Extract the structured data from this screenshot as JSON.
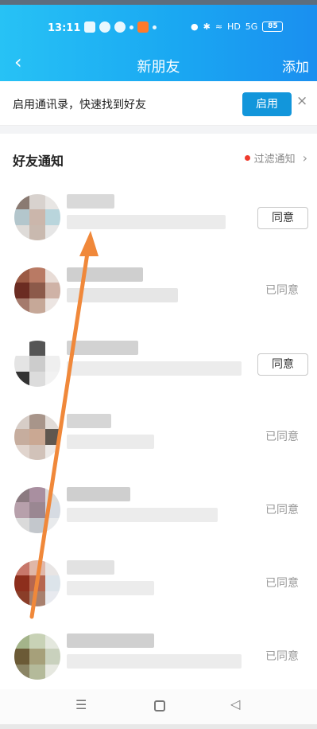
{
  "status_bar": {
    "time": "13:11",
    "icons_left": [
      "calendar-icon",
      "chat-icon",
      "wechat-icon",
      "dot-icon",
      "app-icon-orange",
      "dot-icon"
    ],
    "icons_right": [
      "water-drop-icon",
      "bluetooth-icon",
      "wifi-icon",
      "hd-icon",
      "signal-icon"
    ],
    "hd_label": "HD",
    "signal_label": "5G",
    "battery": "85"
  },
  "header": {
    "back_label": "‹",
    "title": "新朋友",
    "action_label": "添加",
    "gradient_start": "#27c2f5",
    "gradient_end": "#1a8ff0"
  },
  "enable_bar": {
    "text": "启用通讯录，快速找到好友",
    "button_label": "启用",
    "close_label": "×",
    "button_color": "#1296db"
  },
  "friend_notice": {
    "title": "好友通知",
    "filter_label": "过滤通知",
    "chevron": "›",
    "dot_color": "#ef3b2d"
  },
  "requests": [
    {
      "name": "",
      "message": "",
      "action": "同意",
      "state": "pending"
    },
    {
      "name": "",
      "message": "",
      "action": "已同意",
      "state": "accepted"
    },
    {
      "name": "",
      "message": "",
      "action": "同意",
      "state": "pending"
    },
    {
      "name": "",
      "message": "",
      "action": "已同意",
      "state": "accepted"
    },
    {
      "name": "",
      "message": "",
      "action": "已同意",
      "state": "accepted"
    },
    {
      "name": "",
      "message": "",
      "action": "已同意",
      "state": "accepted"
    },
    {
      "name": "",
      "message": "",
      "action": "已同意",
      "state": "accepted"
    }
  ],
  "bottom_nav": {
    "menu_label": "☰",
    "back_label": "◁"
  },
  "annotation": {
    "arrow_color": "#f0883a"
  }
}
